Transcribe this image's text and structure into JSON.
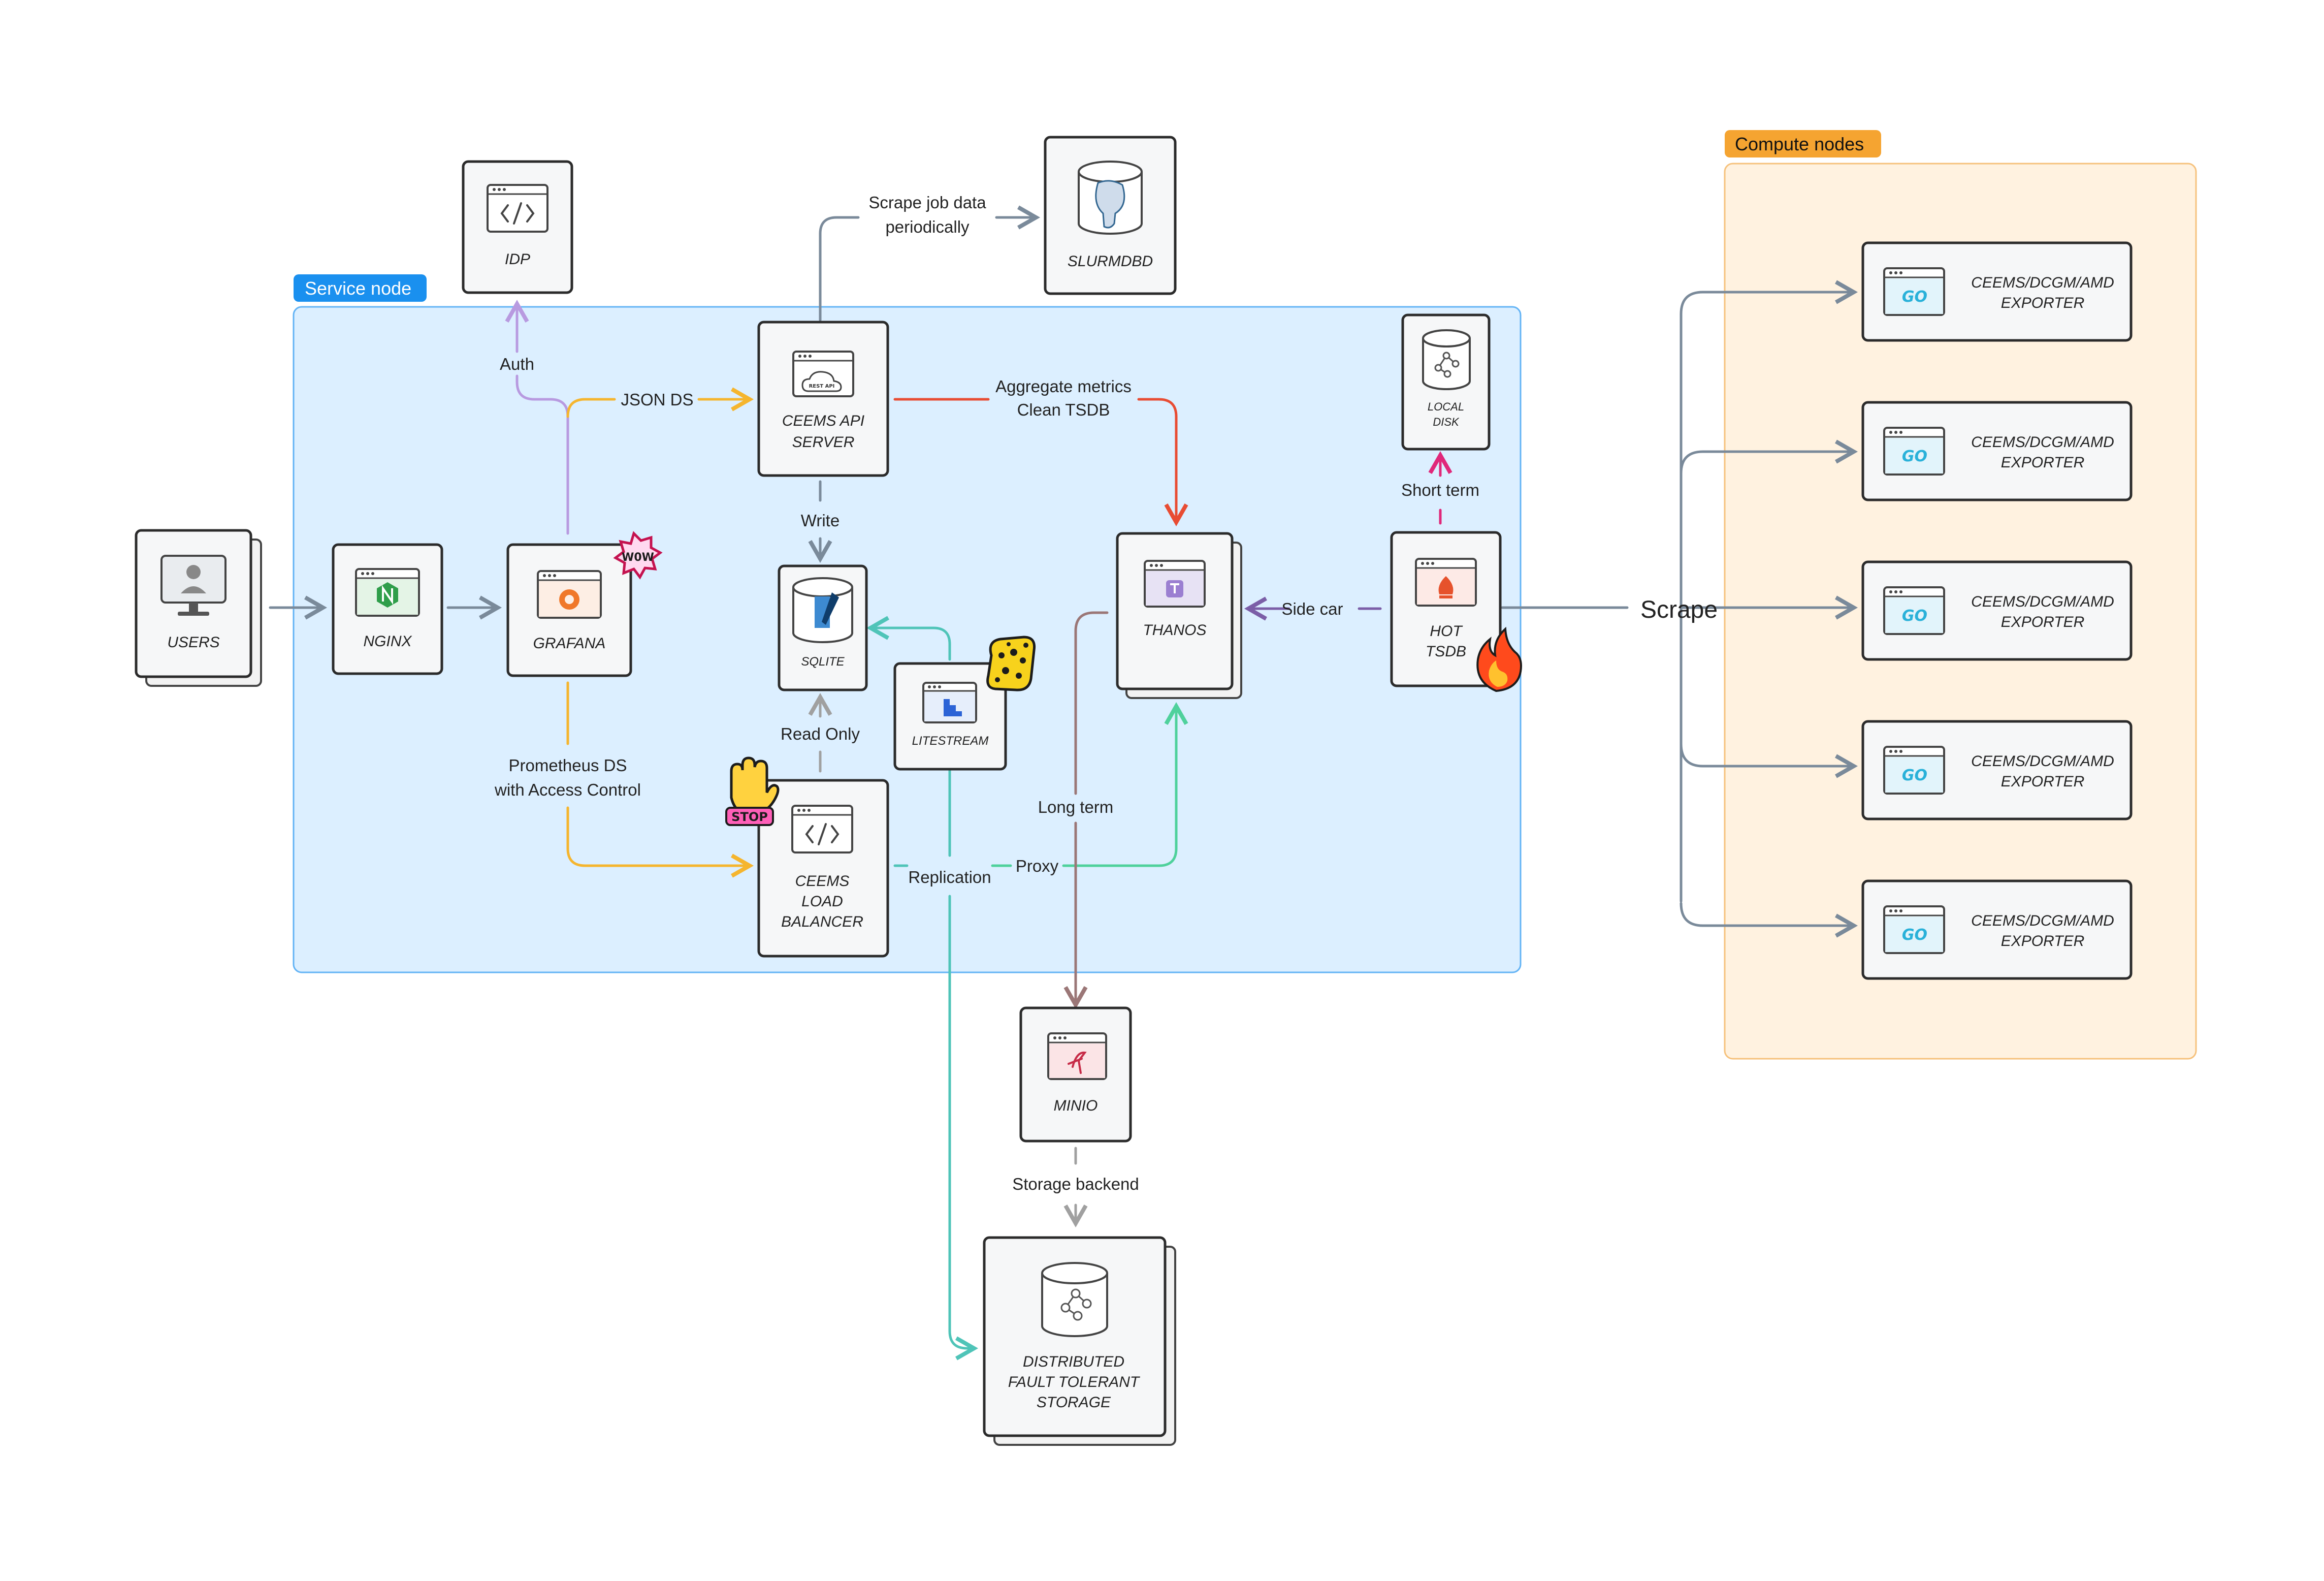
{
  "groups": {
    "service": {
      "label": "Service node"
    },
    "compute": {
      "label": "Compute nodes"
    }
  },
  "nodes": {
    "users": {
      "label": [
        "USERS"
      ]
    },
    "nginx": {
      "label": [
        "NGINX"
      ]
    },
    "grafana": {
      "label": [
        "GRAFANA"
      ]
    },
    "idp": {
      "label": [
        "IDP"
      ]
    },
    "ceems_api": {
      "label": [
        "CEEMS API",
        "SERVER"
      ]
    },
    "slurmdbd": {
      "label": [
        "SLURMDBD"
      ]
    },
    "sqlite": {
      "label": [
        "SQLITE"
      ]
    },
    "litestream": {
      "label": [
        "LITESTREAM"
      ]
    },
    "lb": {
      "label": [
        "CEEMS",
        "LOAD",
        "BALANCER"
      ]
    },
    "thanos": {
      "label": [
        "THANOS"
      ]
    },
    "local_disk": {
      "label": [
        "LOCAL",
        "DISK"
      ]
    },
    "hot_tsdb": {
      "label": [
        "HOT",
        "TSDB"
      ]
    },
    "minio": {
      "label": [
        "MINIO"
      ]
    },
    "storage": {
      "label": [
        "DISTRIBUTED",
        "FAULT TOLERANT",
        "STORAGE"
      ]
    },
    "exporters": [
      {
        "label": [
          "CEEMS/DCGM/AMD",
          "EXPORTER"
        ]
      },
      {
        "label": [
          "CEEMS/DCGM/AMD",
          "EXPORTER"
        ]
      },
      {
        "label": [
          "CEEMS/DCGM/AMD",
          "EXPORTER"
        ]
      },
      {
        "label": [
          "CEEMS/DCGM/AMD",
          "EXPORTER"
        ]
      },
      {
        "label": [
          "CEEMS/DCGM/AMD",
          "EXPORTER"
        ]
      }
    ]
  },
  "edges": {
    "scrape_job": {
      "label": [
        "Scrape job data",
        "periodically"
      ]
    },
    "auth": {
      "label": [
        "Auth"
      ]
    },
    "json_ds": {
      "label": [
        "JSON DS"
      ]
    },
    "aggregate": {
      "label": [
        "Aggregate metrics",
        "Clean TSDB"
      ]
    },
    "write": {
      "label": [
        "Write"
      ]
    },
    "read_only": {
      "label": [
        "Read Only"
      ]
    },
    "prometheus_ds": {
      "label": [
        "Prometheus DS",
        "with Access Control"
      ]
    },
    "replication": {
      "label": [
        "Replication"
      ]
    },
    "proxy": {
      "label": [
        "Proxy"
      ]
    },
    "long_term": {
      "label": [
        "Long term"
      ]
    },
    "side_car": {
      "label": [
        "Side car"
      ]
    },
    "short_term": {
      "label": [
        "Short term"
      ]
    },
    "storage_backend": {
      "label": [
        "Storage backend"
      ]
    },
    "scrape": {
      "label": [
        "Scrape"
      ]
    }
  },
  "stickers": {
    "wow": "W0W",
    "stop": "STOP",
    "rest_api": "REST API",
    "go": "GO"
  },
  "colors": {
    "service_fill": "#dcefff",
    "service_stroke": "#62b3f5",
    "service_tag": "#1a90ef",
    "compute_fill": "#fff2e0",
    "compute_stroke": "#f6c27d",
    "compute_tag": "#f5a431",
    "gray_edge": "#7a8a9a",
    "orange_edge": "#f5b52e",
    "purple_edge": "#b89ae0",
    "red_edge": "#e84c33",
    "teal_edge": "#4fc4b8",
    "green_edge": "#4fd19c",
    "brown_edge": "#9b7777",
    "pink_edge": "#e0287a",
    "violet_edge": "#7b5ea7"
  }
}
